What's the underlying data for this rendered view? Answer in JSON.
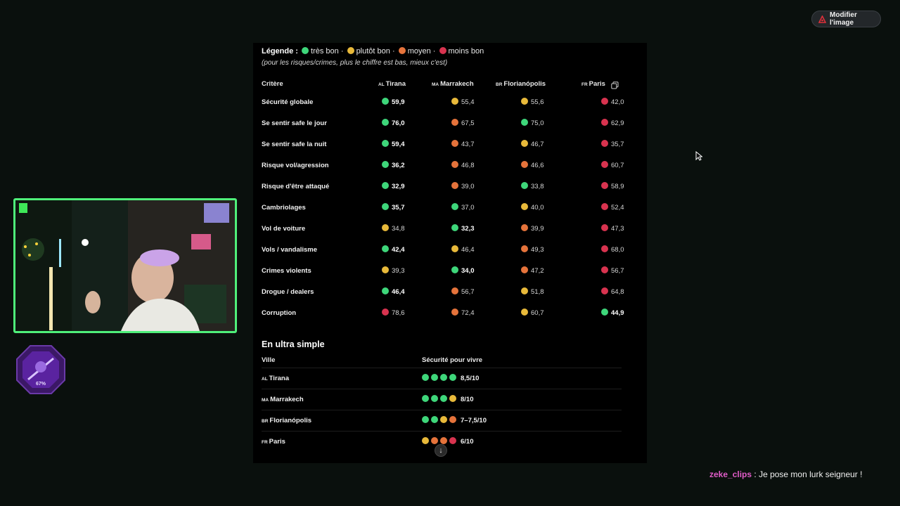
{
  "toolbar": {
    "edit_label": "Modifier l'image",
    "edit_icon": "pdf-icon"
  },
  "legend": {
    "title": "Légende :",
    "items": [
      {
        "label": "très bon",
        "color": "#3ed67a"
      },
      {
        "label": "plutôt bon",
        "color": "#e8b93a"
      },
      {
        "label": "moyen",
        "color": "#e5733b"
      },
      {
        "label": "moins bon",
        "color": "#d8334f"
      }
    ],
    "separator": "·",
    "note": "(pour les risques/crimes, plus le chiffre est bas, mieux c'est)"
  },
  "table": {
    "criterion_header": "Critère",
    "cities": [
      {
        "code": "AL",
        "name": "Tirana"
      },
      {
        "code": "MA",
        "name": "Marrakech"
      },
      {
        "code": "BR",
        "name": "Florianópolis"
      },
      {
        "code": "FR",
        "name": "Paris"
      }
    ],
    "rows": [
      {
        "label": "Sécurité globale",
        "cells": [
          {
            "v": "59,9",
            "c": "g",
            "best": true
          },
          {
            "v": "55,4",
            "c": "y"
          },
          {
            "v": "55,6",
            "c": "y"
          },
          {
            "v": "42,0",
            "c": "r"
          }
        ]
      },
      {
        "label": "Se sentir safe le jour",
        "cells": [
          {
            "v": "76,0",
            "c": "g",
            "best": true
          },
          {
            "v": "67,5",
            "c": "o"
          },
          {
            "v": "75,0",
            "c": "g"
          },
          {
            "v": "62,9",
            "c": "r"
          }
        ]
      },
      {
        "label": "Se sentir safe la nuit",
        "cells": [
          {
            "v": "59,4",
            "c": "g",
            "best": true
          },
          {
            "v": "43,7",
            "c": "o"
          },
          {
            "v": "46,7",
            "c": "y"
          },
          {
            "v": "35,7",
            "c": "r"
          }
        ]
      },
      {
        "label": "Risque vol/agression",
        "cells": [
          {
            "v": "36,2",
            "c": "g",
            "best": true
          },
          {
            "v": "46,8",
            "c": "o"
          },
          {
            "v": "46,6",
            "c": "o"
          },
          {
            "v": "60,7",
            "c": "r"
          }
        ]
      },
      {
        "label": "Risque d'être attaqué",
        "cells": [
          {
            "v": "32,9",
            "c": "g",
            "best": true
          },
          {
            "v": "39,0",
            "c": "o"
          },
          {
            "v": "33,8",
            "c": "g"
          },
          {
            "v": "58,9",
            "c": "r"
          }
        ]
      },
      {
        "label": "Cambriolages",
        "cells": [
          {
            "v": "35,7",
            "c": "g",
            "best": true
          },
          {
            "v": "37,0",
            "c": "g"
          },
          {
            "v": "40,0",
            "c": "y"
          },
          {
            "v": "52,4",
            "c": "r"
          }
        ]
      },
      {
        "label": "Vol de voiture",
        "cells": [
          {
            "v": "34,8",
            "c": "y"
          },
          {
            "v": "32,3",
            "c": "g",
            "best": true
          },
          {
            "v": "39,9",
            "c": "o"
          },
          {
            "v": "47,3",
            "c": "r"
          }
        ]
      },
      {
        "label": "Vols / vandalisme",
        "cells": [
          {
            "v": "42,4",
            "c": "g",
            "best": true
          },
          {
            "v": "46,4",
            "c": "y"
          },
          {
            "v": "49,3",
            "c": "o"
          },
          {
            "v": "68,0",
            "c": "r"
          }
        ]
      },
      {
        "label": "Crimes violents",
        "cells": [
          {
            "v": "39,3",
            "c": "y"
          },
          {
            "v": "34,0",
            "c": "g",
            "best": true
          },
          {
            "v": "47,2",
            "c": "o"
          },
          {
            "v": "56,7",
            "c": "r"
          }
        ]
      },
      {
        "label": "Drogue / dealers",
        "cells": [
          {
            "v": "46,4",
            "c": "g",
            "best": true
          },
          {
            "v": "56,7",
            "c": "o"
          },
          {
            "v": "51,8",
            "c": "y"
          },
          {
            "v": "64,8",
            "c": "r"
          }
        ]
      },
      {
        "label": "Corruption",
        "cells": [
          {
            "v": "78,6",
            "c": "r"
          },
          {
            "v": "72,4",
            "c": "o"
          },
          {
            "v": "60,7",
            "c": "y"
          },
          {
            "v": "44,9",
            "c": "g",
            "best": true
          }
        ]
      }
    ]
  },
  "summary": {
    "title": "En ultra simple",
    "col_city": "Ville",
    "col_score": "Sécurité pour vivre",
    "rows": [
      {
        "code": "AL",
        "city": "Tirana",
        "dots": [
          "g",
          "g",
          "g",
          "g"
        ],
        "score": "8,5/10"
      },
      {
        "code": "MA",
        "city": "Marrakech",
        "dots": [
          "g",
          "g",
          "g",
          "y"
        ],
        "score": "8/10"
      },
      {
        "code": "BR",
        "city": "Florianópolis",
        "dots": [
          "g",
          "g",
          "y",
          "o"
        ],
        "score": "7–7,5/10"
      },
      {
        "code": "FR",
        "city": "Paris",
        "dots": [
          "y",
          "o",
          "o",
          "r"
        ],
        "score": "6/10"
      }
    ]
  },
  "badge": {
    "percent": "67%"
  },
  "chat": {
    "user": "zeke_clips",
    "separator": " : ",
    "message": "Je pose mon lurk seigneur !"
  }
}
